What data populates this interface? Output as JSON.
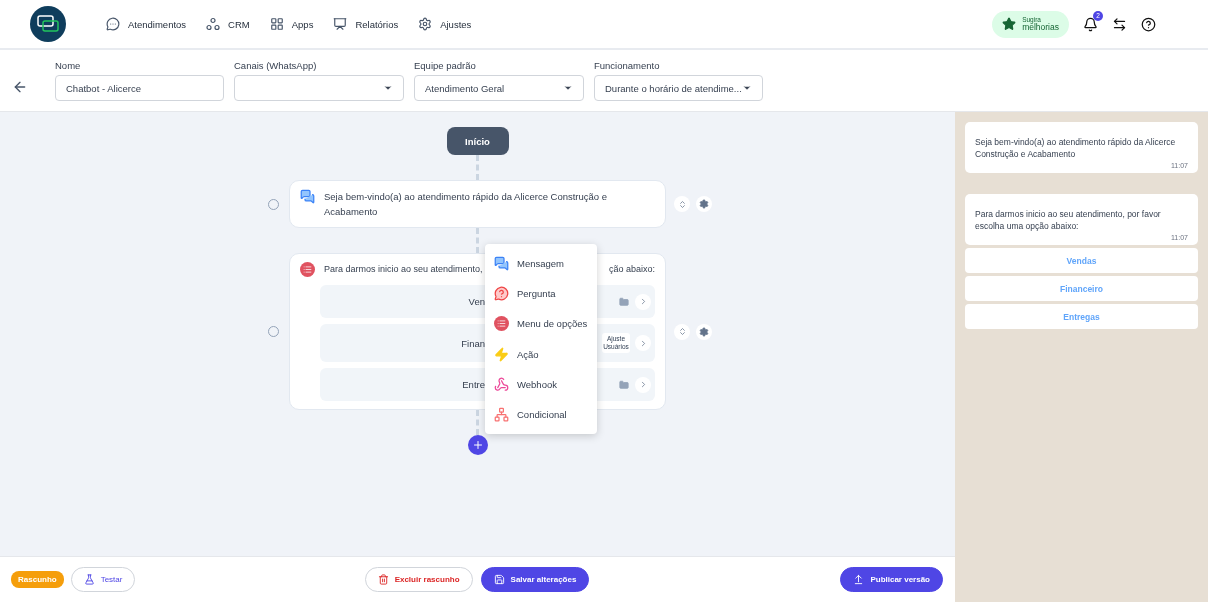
{
  "nav": {
    "items": [
      {
        "label": "Atendimentos"
      },
      {
        "label": "CRM"
      },
      {
        "label": "Apps"
      },
      {
        "label": "Relatórios"
      },
      {
        "label": "Ajustes"
      }
    ],
    "suggest": {
      "line1": "Sugira",
      "line2": "melhorias"
    },
    "notifications": "2"
  },
  "form": {
    "fields": [
      {
        "label": "Nome",
        "value": "Chatbot - Alicerce",
        "kind": "text"
      },
      {
        "label": "Canais (WhatsApp)",
        "kind": "select"
      },
      {
        "label": "Equipe padrão",
        "value": "Atendimento Geral",
        "kind": "select"
      },
      {
        "label": "Funcionamento",
        "value": "Durante o horário de atendime...",
        "kind": "select"
      }
    ]
  },
  "flow": {
    "start": "Início",
    "nodes": [
      {
        "kind": "message",
        "selected": false,
        "text": "Seja bem-vindo(a) ao atendimento rápido da Alicerce Construção e Acabamento"
      },
      {
        "kind": "menu",
        "selected": false,
        "text": "Para darmos inicio ao seu atendimento,",
        "text_end": "ção abaixo:",
        "options": [
          {
            "label": "Ven",
            "kind": "folder"
          },
          {
            "label": "Finan",
            "kind": "tag",
            "tag": "Ajuste Usuários"
          },
          {
            "label": "Entre",
            "kind": "folder"
          }
        ]
      }
    ],
    "menu": [
      {
        "label": "Mensagem",
        "kind": "message"
      },
      {
        "label": "Pergunta",
        "kind": "question"
      },
      {
        "label": "Menu de opções",
        "kind": "menu"
      },
      {
        "label": "Ação",
        "kind": "action"
      },
      {
        "label": "Webhook",
        "kind": "webhook"
      },
      {
        "label": "Condicional",
        "kind": "conditional"
      }
    ]
  },
  "preview": {
    "messages": [
      {
        "text": "Seja bem-vindo(a) ao atendimento rápido da Alicerce Construção e Acabamento",
        "time": "11:07"
      },
      {
        "text": "Para darmos inicio ao seu atendimento, por favor escolha uma opção abaixo:",
        "time": "11:07"
      }
    ],
    "buttons": [
      "Vendas",
      "Financeiro",
      "Entregas"
    ]
  },
  "footer": {
    "status": "Rascunho",
    "test": "Testar",
    "discard": "Excluir rascunho",
    "save": "Salvar alterações",
    "publish": "Publicar versão"
  }
}
